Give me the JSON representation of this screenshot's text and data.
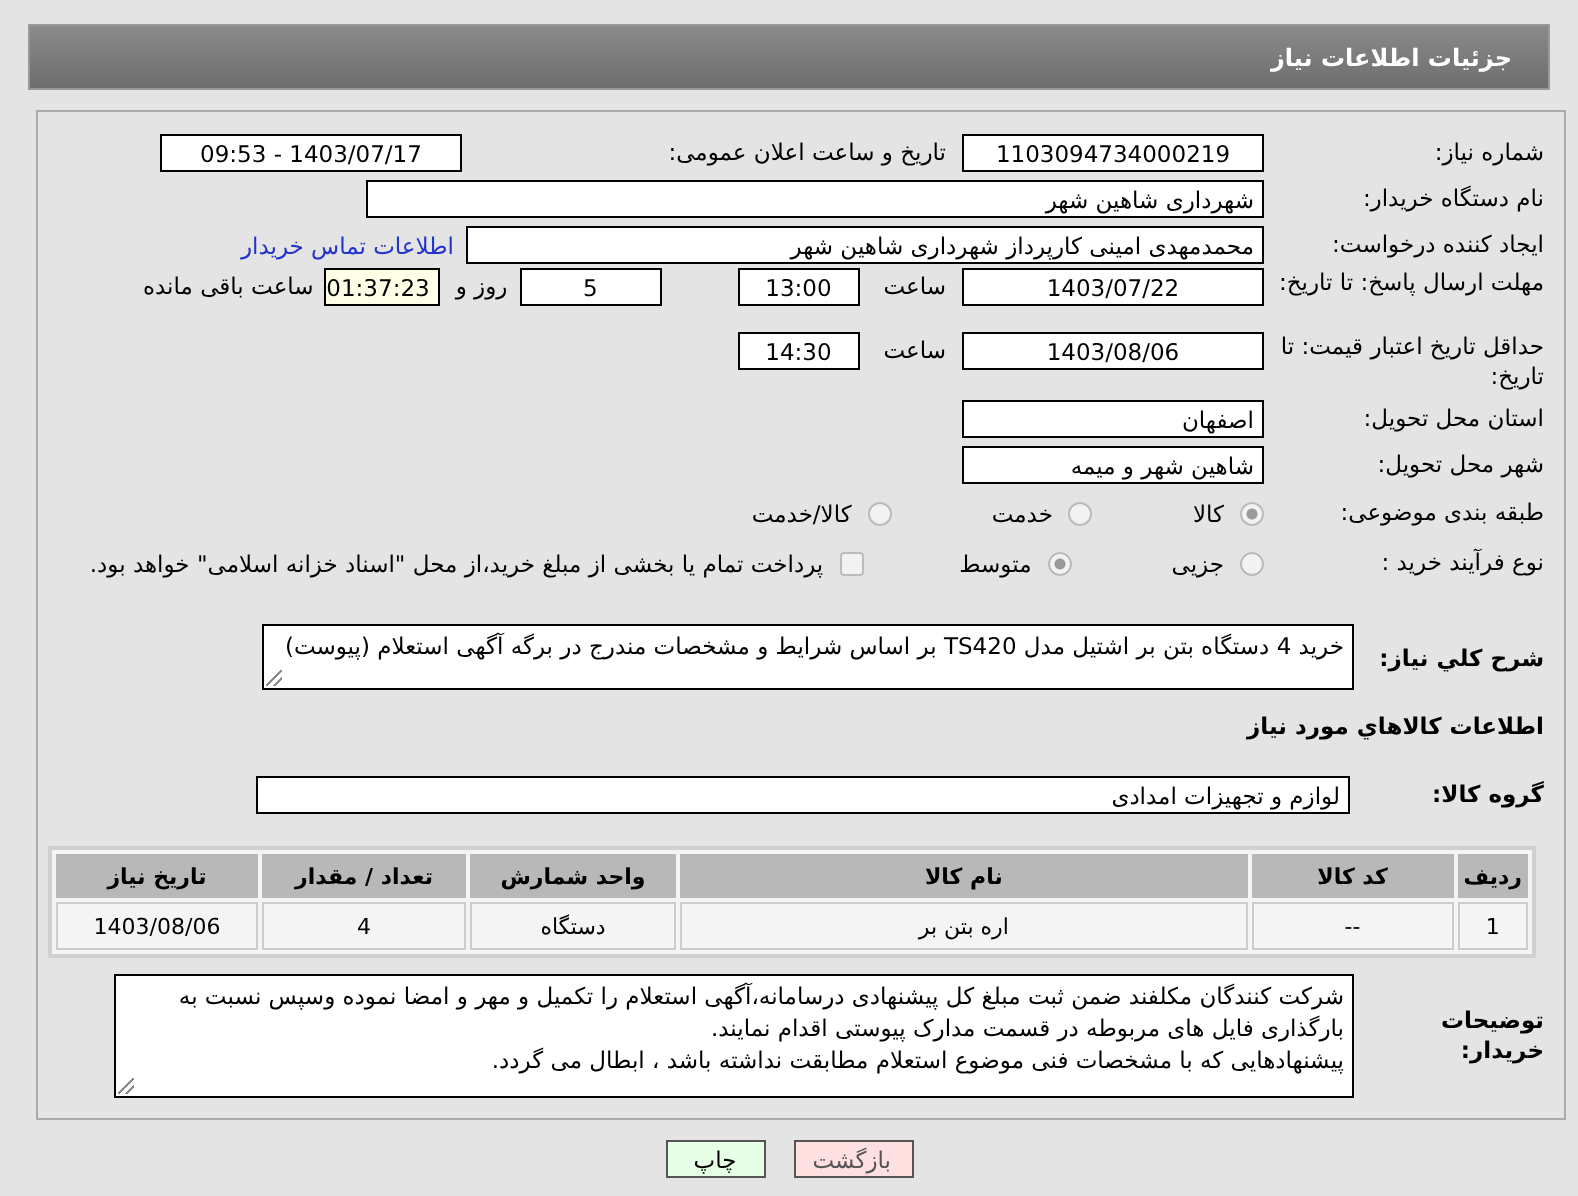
{
  "header": {
    "title": "جزئیات اطلاعات نیاز"
  },
  "need_number": {
    "label": "شماره نیاز:",
    "value": "1103094734000219"
  },
  "announce": {
    "label": "تاریخ و ساعت اعلان عمومی:",
    "value": "1403/07/17 - 09:53"
  },
  "buyer": {
    "label": "نام دستگاه خریدار:",
    "value": "شهرداری شاهین شهر"
  },
  "requester": {
    "label": "ایجاد کننده درخواست:",
    "value": "محمدمهدی امینی کارپرداز شهرداری شاهین شهر",
    "link": "اطلاعات تماس خریدار"
  },
  "deadline": {
    "label": "مهلت ارسال پاسخ: تا تاریخ:",
    "date": "1403/07/22",
    "time_label": "ساعت",
    "time": "13:00",
    "days": "5",
    "days_label": "روز و",
    "remaining": "01:37:23",
    "remaining_label": "ساعت باقی مانده"
  },
  "validity": {
    "label": "حداقل تاریخ اعتبار قیمت: تا تاریخ:",
    "date": "1403/08/06",
    "time_label": "ساعت",
    "time": "14:30"
  },
  "province": {
    "label": "استان محل تحویل:",
    "value": "اصفهان"
  },
  "city": {
    "label": "شهر محل تحویل:",
    "value": "شاهین شهر و میمه"
  },
  "category": {
    "label": "طبقه بندی موضوعی:",
    "options": [
      {
        "label": "کالا",
        "selected": true
      },
      {
        "label": "خدمت",
        "selected": false
      },
      {
        "label": "کالا/خدمت",
        "selected": false
      }
    ]
  },
  "process": {
    "label": "نوع فرآیند خرید :",
    "options": [
      {
        "label": "جزیی",
        "selected": false
      },
      {
        "label": "متوسط",
        "selected": true
      }
    ],
    "payment": {
      "label": "پرداخت تمام یا بخشی از مبلغ خرید،از محل \"اسناد خزانه اسلامی\" خواهد بود.",
      "checked": false
    }
  },
  "description": {
    "label": "شرح كلي نياز:",
    "value": "خرید 4 دستگاه بتن بر اشتیل مدل TS420 بر اساس شرایط و مشخصات مندرج در برگه آگهی استعلام (پیوست)"
  },
  "goods_heading": "اطلاعات كالاهاي مورد نياز",
  "group": {
    "label": "گروه کالا:",
    "value": "لوازم و تجهیزات امدادی"
  },
  "table": {
    "columns": [
      "ردیف",
      "کد کالا",
      "نام کالا",
      "واحد شمارش",
      "تعداد / مقدار",
      "تاریخ نیاز"
    ],
    "rows": [
      [
        "1",
        "--",
        "اره بتن بر",
        "دستگاه",
        "4",
        "1403/08/06"
      ]
    ]
  },
  "notes": {
    "label": "توضیحات خریدار:",
    "value": "شرکت کنندگان مکلفند ضمن ثبت مبلغ کل پیشنهادی درسامانه،آگهی استعلام را  تکمیل و مهر و امضا نموده وسپس نسبت به بارگذاری فایل های مربوطه در قسمت مدارک پیوستی اقدام نمایند.\nپیشنهادهایی که با مشخصات فنی موضوع استعلام مطابقت نداشته باشد ، ابطال می گردد."
  },
  "buttons": [
    {
      "label": "بازگشت",
      "kind": "back"
    },
    {
      "label": "چاپ",
      "kind": "print"
    }
  ]
}
